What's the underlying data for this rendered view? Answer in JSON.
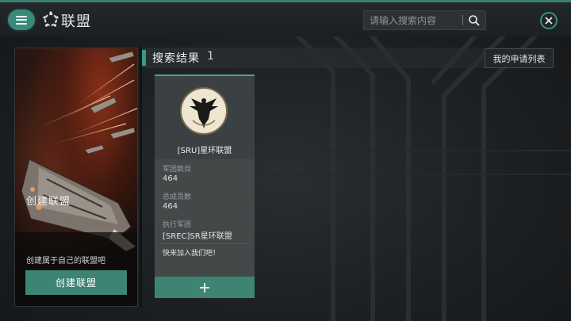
{
  "header": {
    "title": "联盟",
    "menu_icon": "menu-icon",
    "logo_icon": "alliance-logo-icon",
    "search_placeholder": "请输入搜索内容",
    "search_icon": "search-icon",
    "close_icon": "close-icon"
  },
  "create_panel": {
    "title": "创建联盟",
    "description": "创建属于自己的联盟吧",
    "button_label": "创建联盟",
    "image": "spaceship-artwork"
  },
  "results": {
    "title": "搜索结果",
    "count": "1",
    "apply_list_label": "我的申请列表"
  },
  "alliance_card": {
    "emblem_icon": "eagle-emblem-icon",
    "name": "[SRU]星环联盟",
    "legion_count_label": "军团数目",
    "legion_count": "464",
    "member_count_label": "总成员数",
    "member_count": "464",
    "executor_label": "执行军团",
    "executor": "[SREC]SR星环联盟",
    "slogan": "快来加入我们吧！",
    "join_icon": "plus-icon"
  },
  "colors": {
    "accent": "#3d8474",
    "accent_bright": "#2e9e86",
    "background": "#1d2022"
  }
}
